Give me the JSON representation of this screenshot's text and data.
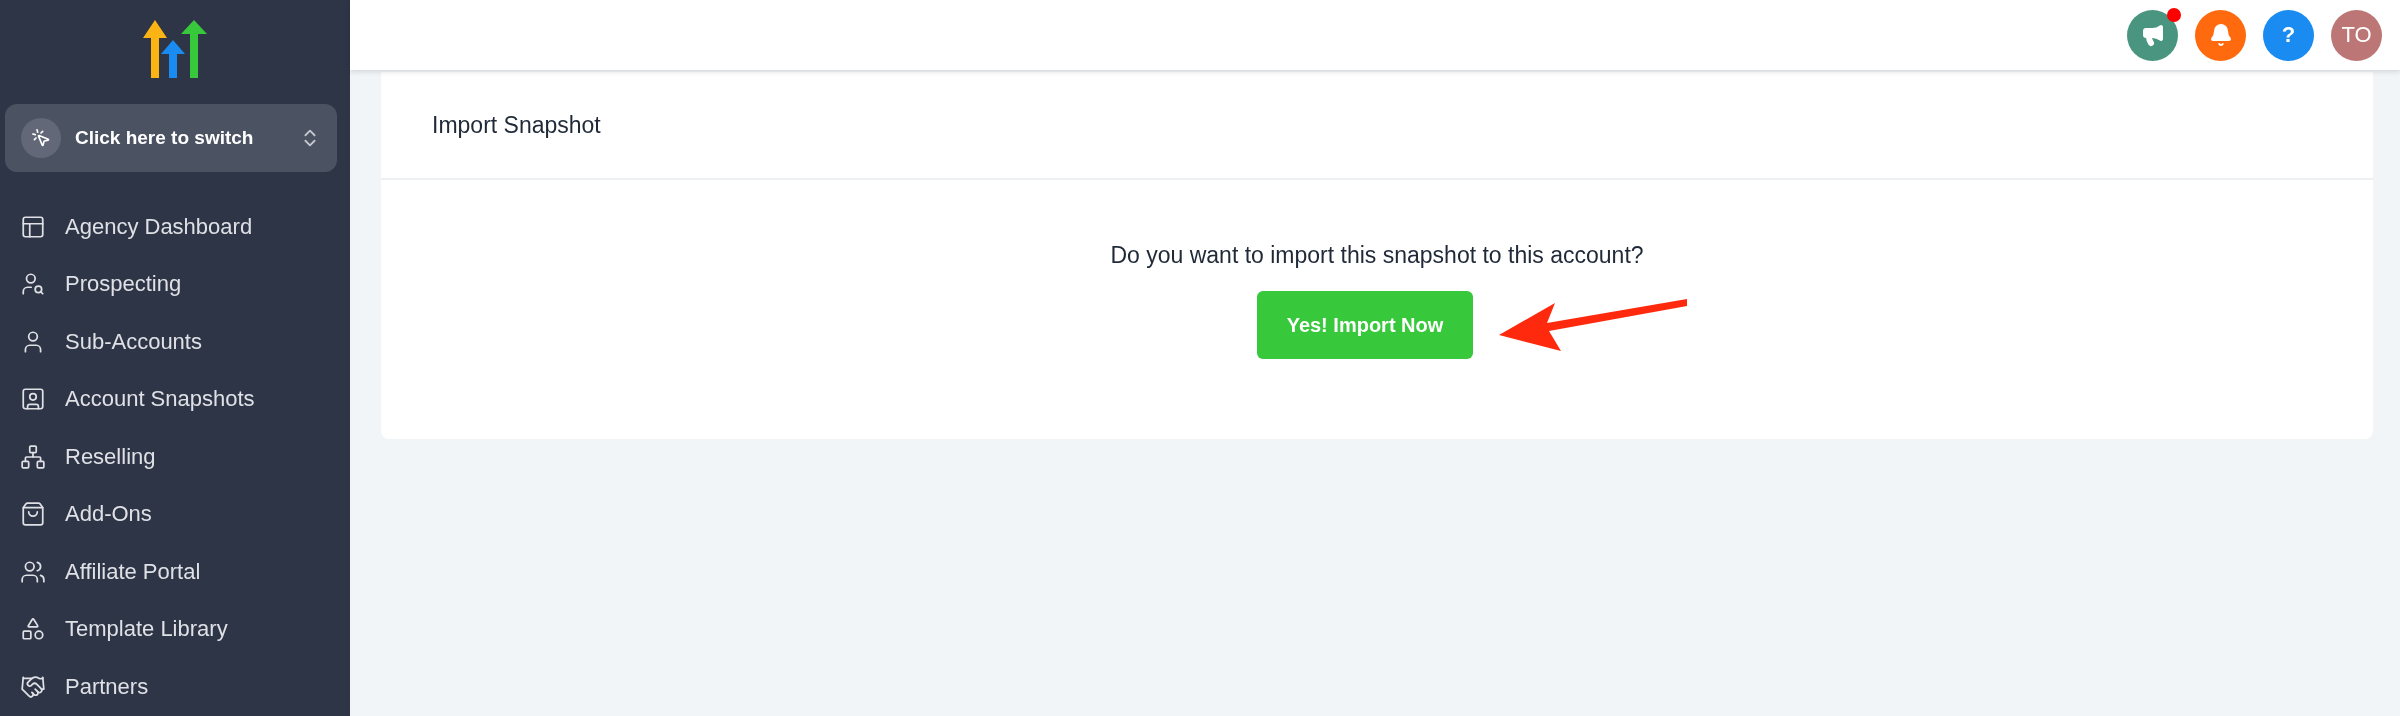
{
  "sidebar": {
    "switcher": {
      "label": "Click here to switch"
    },
    "items": [
      {
        "label": "Agency Dashboard"
      },
      {
        "label": "Prospecting"
      },
      {
        "label": "Sub-Accounts"
      },
      {
        "label": "Account Snapshots"
      },
      {
        "label": "Reselling"
      },
      {
        "label": "Add-Ons"
      },
      {
        "label": "Affiliate Portal"
      },
      {
        "label": "Template Library"
      },
      {
        "label": "Partners"
      }
    ]
  },
  "header": {
    "buttons": [
      {
        "kind": "megaphone",
        "color": "#4a9580",
        "badge": true
      },
      {
        "kind": "bell",
        "color": "#fe6a0d",
        "badge": false
      },
      {
        "kind": "help",
        "color": "#1a8bf0",
        "label": "?",
        "badge": false
      },
      {
        "kind": "avatar",
        "color": "#bd7676",
        "label": "TO",
        "badge": false
      }
    ]
  },
  "card": {
    "title": "Import Snapshot",
    "question": "Do you want to import this snapshot to this account?",
    "button": "Yes! Import Now"
  }
}
